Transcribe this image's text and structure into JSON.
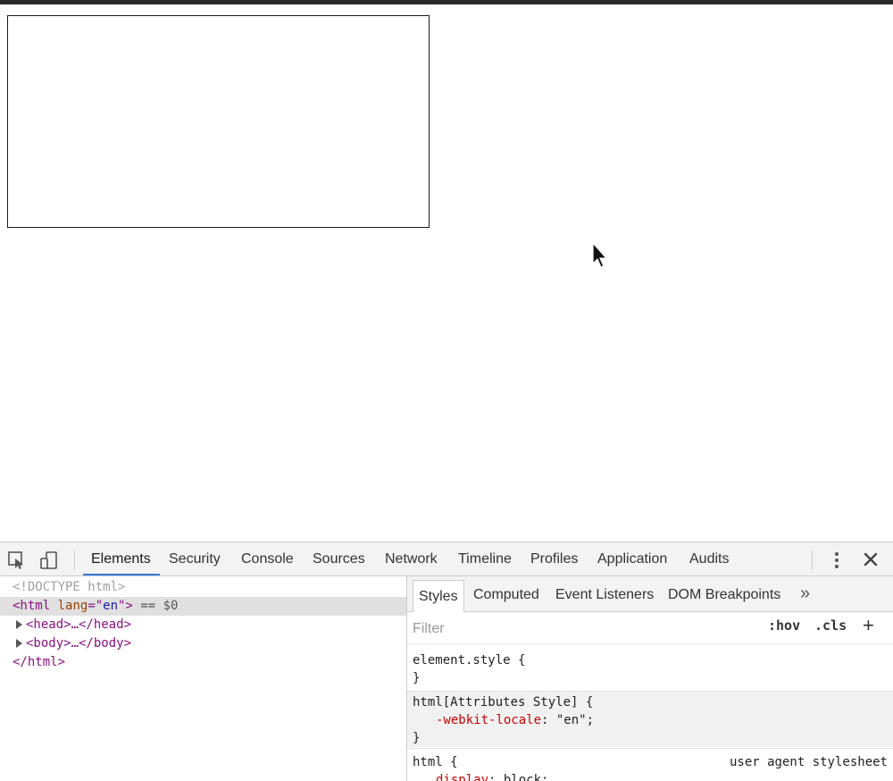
{
  "devtools": {
    "tabs": [
      "Elements",
      "Security",
      "Console",
      "Sources",
      "Network",
      "Timeline",
      "Profiles",
      "Application",
      "Audits"
    ],
    "active_tab": "Elements",
    "icons": {
      "inspect": "inspect-element-icon",
      "device": "device-toolbar-icon",
      "menu": "kebab-menu-icon",
      "close": "close-icon"
    }
  },
  "dom": {
    "doctype": "<!DOCTYPE html>",
    "html_open": "<html",
    "html_attr_name": "lang",
    "html_attr_eq": "=\"",
    "html_attr_value": "en",
    "html_attr_close": "\">",
    "selected_marker": "== $0",
    "head_collapsed": "<head>…</head>",
    "body_collapsed": "<body>…</body>",
    "html_close": "</html>"
  },
  "styles": {
    "tabs": [
      "Styles",
      "Computed",
      "Event Listeners",
      "DOM Breakpoints"
    ],
    "more_label": "»",
    "filter_placeholder": "Filter",
    "hov_label": ":hov",
    "cls_label": ".cls",
    "add_label": "+",
    "rules": [
      {
        "selector": "element.style {",
        "close": "}"
      },
      {
        "selector": "html[Attributes Style] {",
        "property": "-webkit-locale",
        "value": ": \"en\";",
        "close": "}"
      },
      {
        "selector": "html {",
        "source": "user agent stylesheet",
        "property": "display",
        "value": ": block;"
      }
    ]
  }
}
